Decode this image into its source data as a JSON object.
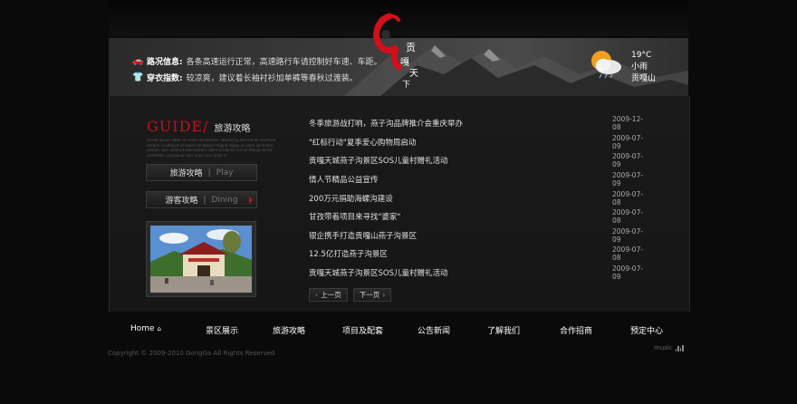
{
  "header": {
    "road_label": "路况信息:",
    "road_text": "各条高速运行正常，高速路行车请控制好车速、车距。",
    "dress_label": "穿衣指数:",
    "dress_text": "较凉爽，建议着长袖衬衫加单裤等春秋过渡装。",
    "logo_text": "贡嘎天下",
    "weather_temp": "19°C",
    "weather_cond": "小雨",
    "weather_place": "贡嘎山",
    "car_icon": "car-icon",
    "shirt_icon": "shirt-icon",
    "weather_icon": "rain-cloud-sun-icon"
  },
  "sidebar": {
    "title_en": "GUIDE/",
    "title_cn": "旅游攻略",
    "desc": "Lorem ipsum dolor sit amet consectetur adipiscing elit sed do eiusmod tempor incididunt ut labore et dolore magna aliqua ut enim ad minim veniam quis nostrud exercitation ullamco laboris nisi ut aliquip ex ea commodo consequat duis aute irure dolor in",
    "btn1_cn": "旅游攻略",
    "btn1_en": "Play",
    "btn2_cn": "游客攻略",
    "btn2_en": "Dining",
    "sep": "|"
  },
  "news": [
    {
      "title": "冬季旅游战打响，燕子沟品牌推介会重庆举办",
      "date": "2009-12-08"
    },
    {
      "title": "\"红标行动\"夏季爱心购物周启动",
      "date": "2009-07-09"
    },
    {
      "title": "贡嘎天城燕子沟景区SOS儿童村赠礼活动",
      "date": "2009-07-09"
    },
    {
      "title": "情人节精品公益宣传",
      "date": "2009-07-09"
    },
    {
      "title": "200万元捐助海螺沟建设",
      "date": "2009-07-08"
    },
    {
      "title": "甘孜带着项目来寻找\"婆家\"",
      "date": "2009-07-08"
    },
    {
      "title": "银企携手打造贡嘎山燕子沟景区",
      "date": "2009-07-09"
    },
    {
      "title": "12.5亿打造燕子沟景区",
      "date": "2009-07-08"
    },
    {
      "title": "贡嘎天城燕子沟景区SOS儿童村赠礼活动",
      "date": "2009-07-09"
    }
  ],
  "pager": {
    "prev": "上一页",
    "next": "下一页"
  },
  "footer": {
    "nav": [
      "Home",
      "景区展示",
      "旅游攻略",
      "项目及配套",
      "公告新闻",
      "了解我们",
      "合作招商",
      "预定中心"
    ],
    "copyright": "Copyright © 2009-2010 GongGa All Rights Reserved",
    "music": "music"
  },
  "colors": {
    "accent": "#c1121c",
    "background": "#0a0a0a"
  }
}
